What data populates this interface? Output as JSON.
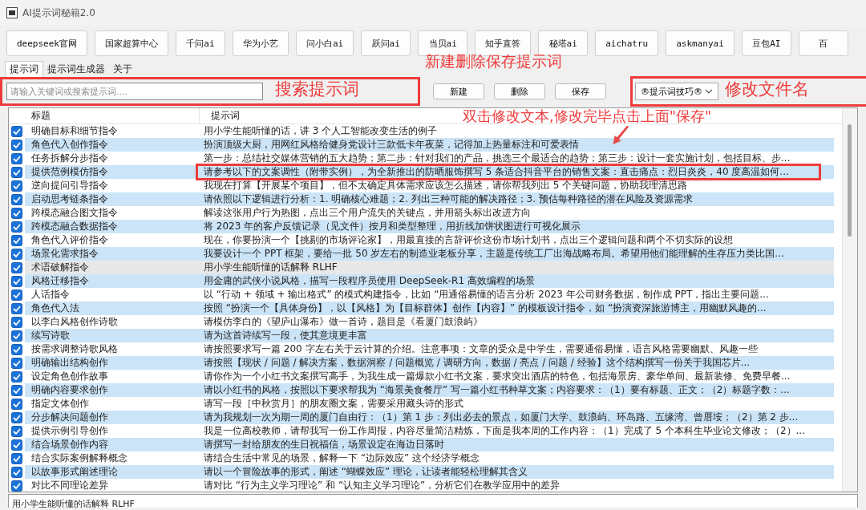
{
  "window": {
    "title": "AI提示词秘籍2.0"
  },
  "site_buttons": [
    "deepseek官网",
    "国家超算中心",
    "千问ai",
    "华为小艺",
    "问小白ai",
    "跃问ai",
    "当贝ai",
    "知乎直答",
    "秘塔ai",
    "aichatru",
    "askmanyai",
    "豆包AI",
    "百"
  ],
  "tabs": [
    {
      "label": "提示词",
      "selected": true
    },
    {
      "label": "提示词生成器",
      "selected": false
    },
    {
      "label": "关于",
      "selected": false
    }
  ],
  "actions": {
    "annotation": "新建删除保存提示词",
    "buttons": [
      "新建",
      "删除",
      "保存"
    ]
  },
  "search": {
    "placeholder": "请输入关键词或搜索提示词....",
    "highlighted": true,
    "annotation": "搜索提示词"
  },
  "file_select": {
    "value": "®提示词技巧®",
    "highlighted": true,
    "annotation": "修改文件名"
  },
  "table": {
    "annotation": "双击修改文本,修改完毕点击上面\"保存\"",
    "columns": [
      "标题",
      "提示词"
    ],
    "rows": [
      {
        "checked": true,
        "selected": false,
        "highlighted": false,
        "title": "明确目标和细节指令",
        "prompt": "用小学生能听懂的话，讲 3 个人工智能改变生活的例子"
      },
      {
        "checked": true,
        "selected": false,
        "highlighted": false,
        "title": "角色代入创作指令",
        "prompt": "扮演顶级大厨，用网红风格给健身党设计三款低卡年夜菜，记得加上热量标注和可爱表情"
      },
      {
        "checked": true,
        "selected": false,
        "highlighted": false,
        "title": "任务拆解分步指令",
        "prompt": "第一步：总结社交媒体营销的五大趋势；第二步：针对我们的产品，挑选三个最适合的趋势；第三步：设计一套实施计划，包括目标、步..."
      },
      {
        "checked": true,
        "selected": false,
        "highlighted": true,
        "title": "提供范例模仿指令",
        "prompt": "请参考以下的文案调性（附带实例），为全新推出的防晒服饰撰写 5 条适合抖音平台的销售文案：直击痛点：烈日炎炎，40 度高温如何..."
      },
      {
        "checked": true,
        "selected": false,
        "highlighted": false,
        "title": "逆向提问引导指令",
        "prompt": "我现在打算【开展某个项目】，但不太确定具体需求应该怎么描述，请你帮我列出 5 个关键问题，协助我理清思路"
      },
      {
        "checked": true,
        "selected": false,
        "highlighted": false,
        "title": "启动思考链条指令",
        "prompt": "请依照以下逻辑进行分析：1. 明确核心难题；2. 列出三种可能的解决路径；3. 预估每种路径的潜在风险及资源需求"
      },
      {
        "checked": true,
        "selected": false,
        "highlighted": false,
        "title": "跨模态融合图文指令",
        "prompt": "解读这张用户行为热图，点出三个用户流失的关键点，并用箭头标出改进方向"
      },
      {
        "checked": true,
        "selected": false,
        "highlighted": false,
        "title": "跨模态融合数据指令",
        "prompt": "将 2023 年的客户反馈记录（见文件）按月和类型整理，用折线加饼状图进行可视化展示"
      },
      {
        "checked": true,
        "selected": false,
        "highlighted": false,
        "title": "角色代入评价指令",
        "prompt": "现在，你要扮演一个【挑剔的市场评论家】，用最直接的言辞评价这份市场计划书，点出三个逻辑问题和两个不切实际的设想"
      },
      {
        "checked": true,
        "selected": false,
        "highlighted": false,
        "title": "场景化需求指令",
        "prompt": "我要设计一个 PPT 框架，要给一批 50 岁左右的制造业老板分享，主题是传统工厂出海战略布局。希望用他们能理解的生存压力类比国..."
      },
      {
        "checked": true,
        "selected": true,
        "highlighted": false,
        "title": "术语破解指令",
        "prompt": "用小学生能听懂的话解释 RLHF"
      },
      {
        "checked": true,
        "selected": false,
        "highlighted": false,
        "title": "风格迁移指令",
        "prompt": "用金庸的武侠小说风格，描写一段程序员使用 DeepSeek-R1 高效编程的场景"
      },
      {
        "checked": true,
        "selected": false,
        "highlighted": false,
        "title": "人话指令",
        "prompt": "以 “行动 + 领域 + 输出格式” 的模式构建指令，比如 “用通俗易懂的语言分析 2023 年公司财务数据，制作成 PPT，指出主要问题..."
      },
      {
        "checked": true,
        "selected": false,
        "highlighted": false,
        "title": "角色代入法",
        "prompt": "按照 “扮演一个【具体身份】，以【风格】为【目标群体】创作【内容】” 的模板设计指令，如 “扮演资深旅游博主，用幽默风趣的..."
      },
      {
        "checked": true,
        "selected": false,
        "highlighted": false,
        "title": "以李白风格创作诗歌",
        "prompt": "请模仿李白的《望庐山瀑布》做一首诗，题目是《看厦门鼓浪屿》"
      },
      {
        "checked": true,
        "selected": false,
        "highlighted": false,
        "title": "续写诗歌",
        "prompt": "请为这首诗续写一段，使其意境更丰富"
      },
      {
        "checked": true,
        "selected": false,
        "highlighted": false,
        "title": "按需求调整诗歌风格",
        "prompt": "请按照要求写一篇 200 字左右关于云计算的介绍。注意事项：文章的受众是中学生，需要通俗易懂，语言风格需要幽默、风趣一些"
      },
      {
        "checked": true,
        "selected": false,
        "highlighted": false,
        "title": "明确输出结构创作",
        "prompt": "请按照【现状 / 问题 / 解决方案，数据洞察 / 问题概览 / 调研方向，数据 / 亮点 / 问题 / 经验】这个结构撰写一份关于我国芯片..."
      },
      {
        "checked": true,
        "selected": false,
        "highlighted": false,
        "title": "设定角色创作故事",
        "prompt": "请你作为一个小红书文案撰写高手，为我生成一篇爆款小红书文案，要求突出酒店的特色，包括海景房、豪华单间、最新装修、免费早餐..."
      },
      {
        "checked": true,
        "selected": false,
        "highlighted": false,
        "title": "明确内容要求创作",
        "prompt": "请以小红书的风格，按照以下要求帮我为 “海景美食餐厅” 写一篇小红书种草文案；内容要求：（1）要有标题、正文；（2）标题字数：..."
      },
      {
        "checked": true,
        "selected": false,
        "highlighted": false,
        "title": "指定文体创作",
        "prompt": "请写一段［中秋赏月］的朋友圈文案，需要采用藏头诗的形式"
      },
      {
        "checked": true,
        "selected": false,
        "highlighted": false,
        "title": "分步解决问题创作",
        "prompt": "请为我规划一次为期一周的厦门自由行：（1）第 1 步：列出必去的景点，如厦门大学、鼓浪屿、环岛路、五缘湾、曾厝垵；（2）第 2 步..."
      },
      {
        "checked": true,
        "selected": false,
        "highlighted": false,
        "title": "提供示例引导创作",
        "prompt": "我是一位高校教师，请帮我写一份工作周报，内容尽量简洁精炼，下面是我本周的工作内容：（1）完成了 5 个本科生毕业论文修改；（2）..."
      },
      {
        "checked": true,
        "selected": false,
        "highlighted": false,
        "title": "结合场景创作内容",
        "prompt": "请撰写一封给朋友的生日祝福信，场景设定在海边日落时"
      },
      {
        "checked": true,
        "selected": false,
        "highlighted": false,
        "title": "结合实际案例解释概念",
        "prompt": "请结合生活中常见的场景，解释一下 “边际效应” 这个经济学概念"
      },
      {
        "checked": true,
        "selected": false,
        "highlighted": false,
        "title": "以故事形式阐述理论",
        "prompt": "请以一个冒险故事的形式，阐述 “蝴蝶效应” 理论，让读者能轻松理解其含义"
      },
      {
        "checked": true,
        "selected": false,
        "highlighted": false,
        "title": "对比不同理论差异",
        "prompt": "请对比 “行为主义学习理论” 和 “认知主义学习理论”，分析它们在教学应用中的差异"
      }
    ]
  },
  "detail": {
    "text": "用小学生能听懂的话解释 RLHF"
  }
}
